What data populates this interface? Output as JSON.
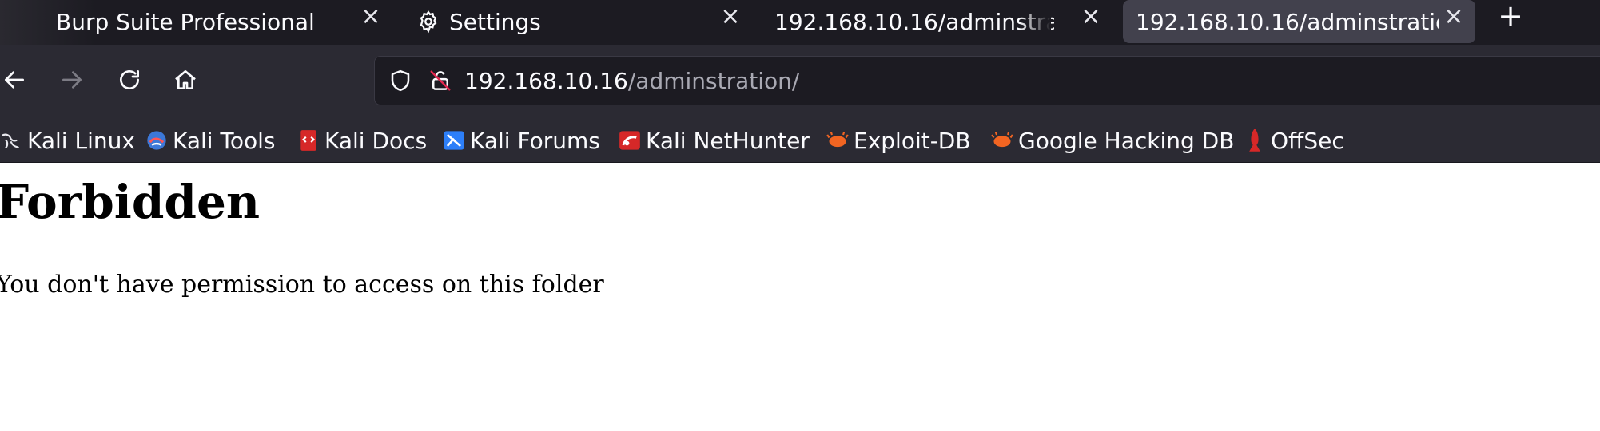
{
  "tabs": [
    {
      "title": "Burp Suite Professional",
      "active": false
    },
    {
      "title": "Settings",
      "icon": "gear-icon",
      "active": false
    },
    {
      "title": "192.168.10.16/adminstration/",
      "active": false
    },
    {
      "title": "192.168.10.16/adminstration/",
      "active": true
    }
  ],
  "new_tab_label": "+",
  "close_glyph": "×",
  "nav": {
    "back_icon": "arrow-left-icon",
    "forward_icon": "arrow-right-icon",
    "reload_icon": "reload-icon",
    "home_icon": "home-icon"
  },
  "urlbar": {
    "host": "192.168.10.16",
    "path": "/adminstration/",
    "security_icon": "shield-icon",
    "insecure_icon": "lock-strikethrough-icon"
  },
  "bookmarks": [
    {
      "label": "Kali Linux",
      "icon": "kali-dragon-icon"
    },
    {
      "label": "Kali Tools",
      "icon": "kali-tools-icon"
    },
    {
      "label": "Kali Docs",
      "icon": "kali-docs-icon"
    },
    {
      "label": "Kali Forums",
      "icon": "kali-forums-icon"
    },
    {
      "label": "Kali NetHunter",
      "icon": "kali-nethunter-icon"
    },
    {
      "label": "Exploit-DB",
      "icon": "exploit-db-icon"
    },
    {
      "label": "Google Hacking DB",
      "icon": "ghdb-icon"
    },
    {
      "label": "OffSec",
      "icon": "offsec-icon"
    }
  ],
  "colors": {
    "tabbar_bg": "#1c1b22",
    "toolbar_bg": "#2b2a33",
    "active_tab_bg": "#42414d",
    "url_path": "#a9a9b3",
    "page_bg": "#ffffff"
  },
  "page": {
    "title": "Forbidden",
    "message": "You don't have permission to access on this folder"
  }
}
